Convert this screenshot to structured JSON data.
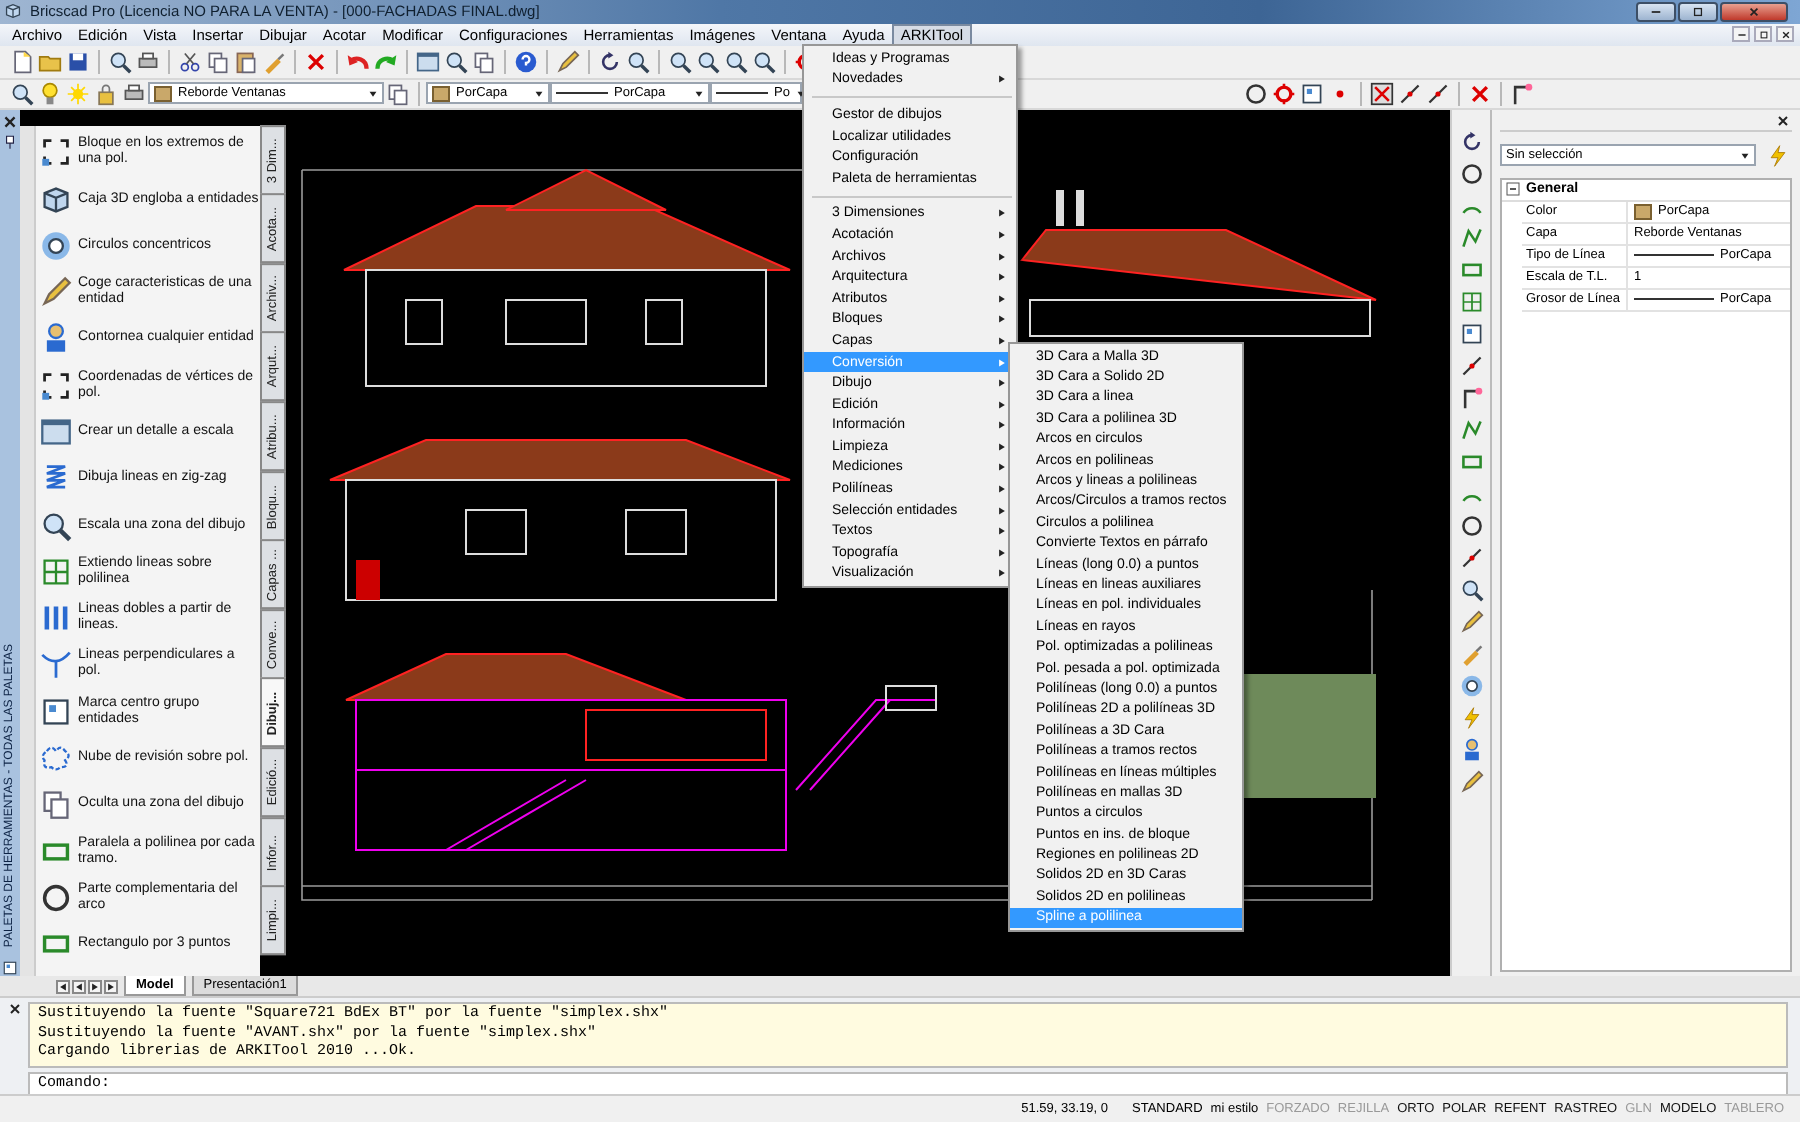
{
  "window": {
    "title": "Bricscad Pro (Licencia NO PARA LA VENTA) - [000-FACHADAS FINAL.dwg]"
  },
  "menu_bar": [
    {
      "label": "Archivo",
      "selected": false
    },
    {
      "label": "Edición",
      "selected": false
    },
    {
      "label": "Vista",
      "selected": false
    },
    {
      "label": "Insertar",
      "selected": false
    },
    {
      "label": "Dibujar",
      "selected": false
    },
    {
      "label": "Acotar",
      "selected": false
    },
    {
      "label": "Modificar",
      "selected": false
    },
    {
      "label": "Configuraciones",
      "selected": false
    },
    {
      "label": "Herramientas",
      "selected": false
    },
    {
      "label": "Imágenes",
      "selected": false
    },
    {
      "label": "Ventana",
      "selected": false
    },
    {
      "label": "Ayuda",
      "selected": false
    },
    {
      "label": "ARKITool",
      "selected": true
    }
  ],
  "layer_toolbar": {
    "layer": "Reborde Ventanas",
    "swatch_label": "PorCapa",
    "linetype": "PorCapa",
    "lineweight": "Po"
  },
  "tool_palette": {
    "title": "PALETAS DE HERRAMIENTAS - TODAS LAS PALETAS",
    "tools": [
      "Bloque en los extremos de una pol.",
      "Caja 3D engloba a entidades",
      "Circulos concentricos",
      "Coge caracteristicas de una entidad",
      "Contornea cualquier entidad",
      "Coordenadas de vértices de pol.",
      "Crear un detalle a escala",
      "Dibuja lineas en zig-zag",
      "Escala una zona del dibujo",
      "Extiendo lineas sobre polilinea",
      "Lineas dobles a partir de lineas.",
      "Lineas perpendiculares a pol.",
      "Marca centro grupo entidades",
      "Nube de revisión sobre pol.",
      "Oculta una zona del dibujo",
      "Paralela a polilinea por cada tramo.",
      "Parte complementaria del arco",
      "Rectangulo por 3 puntos"
    ],
    "tabs": [
      {
        "label": "3 Dim...",
        "selected": false
      },
      {
        "label": "Acota...",
        "selected": false
      },
      {
        "label": "Archiv...",
        "selected": false
      },
      {
        "label": "Arqut...",
        "selected": false
      },
      {
        "label": "Atribu...",
        "selected": false
      },
      {
        "label": "Bloqu...",
        "selected": false
      },
      {
        "label": "Capas ...",
        "selected": false
      },
      {
        "label": "Conve...",
        "selected": false
      },
      {
        "label": "Dibuj...",
        "selected": true
      },
      {
        "label": "Edició...",
        "selected": false
      },
      {
        "label": "Infor...",
        "selected": false
      },
      {
        "label": "Limpi...",
        "selected": false
      }
    ]
  },
  "layout_tabs": [
    {
      "label": "Model",
      "selected": true
    },
    {
      "label": "Presentación1",
      "selected": false
    }
  ],
  "properties": {
    "selection": "Sin selección",
    "section": {
      "title": "General",
      "expanded": true,
      "rows": [
        {
          "name": "Color",
          "value": "PorCapa",
          "kind": "color"
        },
        {
          "name": "Capa",
          "value": "Reborde Ventanas",
          "kind": "text"
        },
        {
          "name": "Tipo de Línea",
          "value": "PorCapa",
          "kind": "line"
        },
        {
          "name": "Escala de T.L.",
          "value": "1",
          "kind": "text"
        },
        {
          "name": "Grosor de Línea",
          "value": "PorCapa",
          "kind": "line"
        }
      ]
    }
  },
  "arkitool_menu": {
    "groups": [
      [
        {
          "label": "Ideas y Programas",
          "submenu": false,
          "selected": false
        },
        {
          "label": "Novedades",
          "submenu": true,
          "selected": false
        }
      ],
      [
        {
          "label": "Gestor de dibujos",
          "submenu": false,
          "selected": false
        },
        {
          "label": "Localizar utilidades",
          "submenu": false,
          "selected": false
        },
        {
          "label": "Configuración",
          "submenu": false,
          "selected": false
        },
        {
          "label": "Paleta de herramientas",
          "submenu": false,
          "selected": false
        }
      ],
      [
        {
          "label": "3 Dimensiones",
          "submenu": true,
          "selected": false
        },
        {
          "label": "Acotación",
          "submenu": true,
          "selected": false
        },
        {
          "label": "Archivos",
          "submenu": true,
          "selected": false
        },
        {
          "label": "Arquitectura",
          "submenu": true,
          "selected": false
        },
        {
          "label": "Atributos",
          "submenu": true,
          "selected": false
        },
        {
          "label": "Bloques",
          "submenu": true,
          "selected": false
        },
        {
          "label": "Capas",
          "submenu": true,
          "selected": false
        },
        {
          "label": "Conversión",
          "submenu": true,
          "selected": true
        },
        {
          "label": "Dibujo",
          "submenu": true,
          "selected": false
        },
        {
          "label": "Edición",
          "submenu": true,
          "selected": false
        },
        {
          "label": "Información",
          "submenu": true,
          "selected": false
        },
        {
          "label": "Limpieza",
          "submenu": true,
          "selected": false
        },
        {
          "label": "Mediciones",
          "submenu": true,
          "selected": false
        },
        {
          "label": "Polilíneas",
          "submenu": true,
          "selected": false
        },
        {
          "label": "Selección entidades",
          "submenu": true,
          "selected": false
        },
        {
          "label": "Textos",
          "submenu": true,
          "selected": false
        },
        {
          "label": "Topografía",
          "submenu": true,
          "selected": false
        },
        {
          "label": "Visualización",
          "submenu": true,
          "selected": false
        }
      ]
    ]
  },
  "conversion_submenu": [
    {
      "label": "3D Cara a Malla 3D",
      "selected": false
    },
    {
      "label": "3D Cara a Solido 2D",
      "selected": false
    },
    {
      "label": "3D Cara a linea",
      "selected": false
    },
    {
      "label": "3D Cara a polilinea 3D",
      "selected": false
    },
    {
      "label": "Arcos en circulos",
      "selected": false
    },
    {
      "label": "Arcos en polilineas",
      "selected": false
    },
    {
      "label": "Arcos y lineas a polilineas",
      "selected": false
    },
    {
      "label": "Arcos/Circulos a tramos rectos",
      "selected": false
    },
    {
      "label": "Circulos a polilinea",
      "selected": false
    },
    {
      "label": "Convierte Textos en párrafo",
      "selected": false
    },
    {
      "label": "Líneas (long 0.0) a puntos",
      "selected": false
    },
    {
      "label": "Líneas en lineas auxiliares",
      "selected": false
    },
    {
      "label": "Líneas en pol. individuales",
      "selected": false
    },
    {
      "label": "Líneas en rayos",
      "selected": false
    },
    {
      "label": "Pol. optimizadas a polilineas",
      "selected": false
    },
    {
      "label": "Pol. pesada a pol. optimizada",
      "selected": false
    },
    {
      "label": "Polilíneas (long 0.0) a puntos",
      "selected": false
    },
    {
      "label": "Polilíneas 2D a polilíneas 3D",
      "selected": false
    },
    {
      "label": "Polilíneas a 3D Cara",
      "selected": false
    },
    {
      "label": "Polilíneas a tramos rectos",
      "selected": false
    },
    {
      "label": "Polilíneas en líneas múltiples",
      "selected": false
    },
    {
      "label": "Polilíneas en mallas 3D",
      "selected": false
    },
    {
      "label": "Puntos a circulos",
      "selected": false
    },
    {
      "label": "Puntos en ins. de bloque",
      "selected": false
    },
    {
      "label": "Regiones en polilineas 2D",
      "selected": false
    },
    {
      "label": "Solidos 2D en 3D Caras",
      "selected": false
    },
    {
      "label": "Solidos 2D en polilineas",
      "selected": false
    },
    {
      "label": "Spline a polilinea",
      "selected": true
    }
  ],
  "command_line": {
    "history": [
      "Sustituyendo la fuente \"Square721 BdEx BT\" por la fuente \"simplex.shx\"",
      "Sustituyendo la fuente \"AVANT.shx\" por la fuente \"simplex.shx\"",
      "Cargando librerias de ARKITool 2010 ...Ok."
    ],
    "prompt": "Comando:"
  },
  "status_bar": {
    "coordinates": "51.59, 33.19, 0",
    "text_style": "STANDARD",
    "dim_style": "mi estilo",
    "toggles": [
      {
        "label": "FORZADO",
        "on": false
      },
      {
        "label": "REJILLA",
        "on": false
      },
      {
        "label": "ORTO",
        "on": true
      },
      {
        "label": "POLAR",
        "on": true
      },
      {
        "label": "REFENT",
        "on": true
      },
      {
        "label": "RASTREO",
        "on": true
      },
      {
        "label": "GLN",
        "on": false
      },
      {
        "label": "MODELO",
        "on": true
      },
      {
        "label": "TABLERO",
        "on": false
      }
    ]
  }
}
